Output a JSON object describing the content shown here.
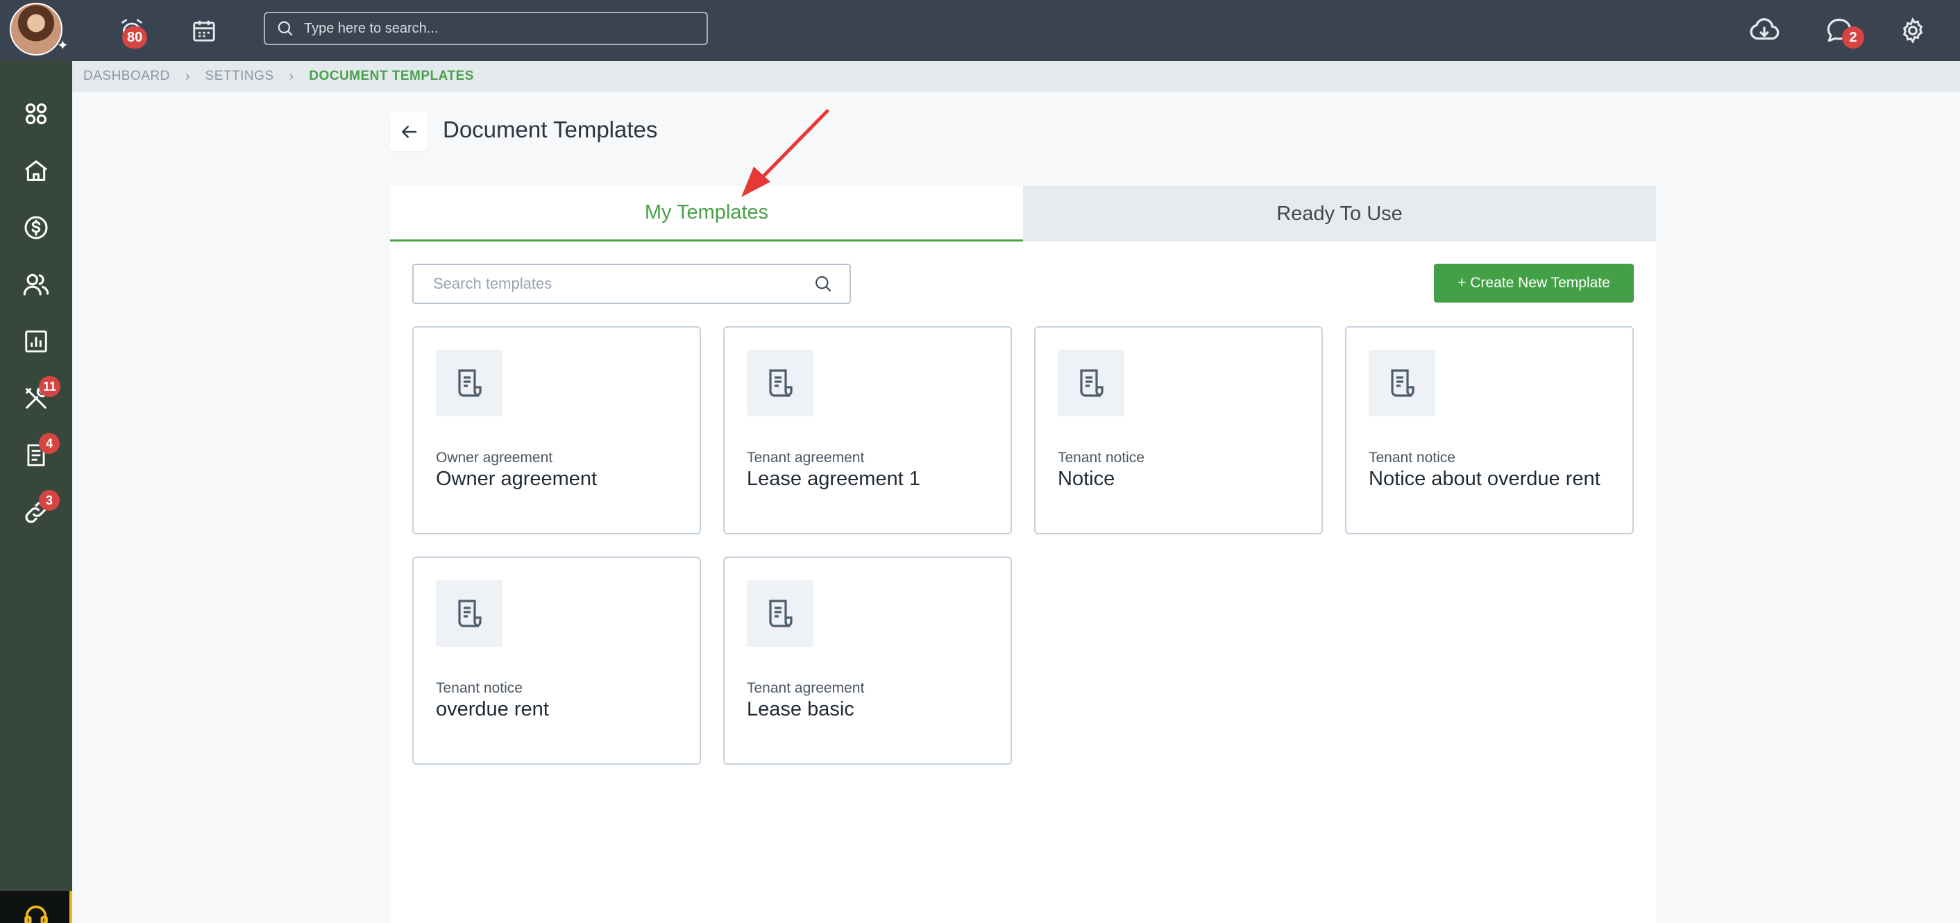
{
  "topbar": {
    "avatar_alt": "User avatar",
    "alarm_badge": "80",
    "search_placeholder": "Type here to search...",
    "messages_badge": "2"
  },
  "sidebar": {
    "items": [
      {
        "icon": "dashboard-grid-icon"
      },
      {
        "icon": "home-icon"
      },
      {
        "icon": "dollar-circle-icon"
      },
      {
        "icon": "people-icon"
      },
      {
        "icon": "reports-chart-icon"
      },
      {
        "icon": "tools-icon",
        "badge": "11"
      },
      {
        "icon": "document-icon",
        "badge": "4"
      },
      {
        "icon": "link-icon",
        "badge": "3"
      }
    ]
  },
  "breadcrumb": {
    "items": [
      "DASHBOARD",
      "SETTINGS",
      "DOCUMENT TEMPLATES"
    ]
  },
  "page": {
    "title": "Document Templates"
  },
  "tabs": [
    {
      "label": "My Templates",
      "active": true
    },
    {
      "label": "Ready To Use",
      "active": false
    }
  ],
  "templates_search": {
    "placeholder": "Search templates"
  },
  "create_button": {
    "label": "+ Create New Template"
  },
  "templates": [
    {
      "category": "Owner agreement",
      "name": "Owner agreement"
    },
    {
      "category": "Tenant agreement",
      "name": "Lease agreement 1"
    },
    {
      "category": "Tenant notice",
      "name": "Notice"
    },
    {
      "category": "Tenant notice",
      "name": "Notice about overdue rent"
    },
    {
      "category": "Tenant notice",
      "name": "overdue rent"
    },
    {
      "category": "Tenant agreement",
      "name": "Lease basic"
    }
  ],
  "colors": {
    "topbar": "#3a4450",
    "sidebar": "#37473b",
    "accent_green": "#43a047",
    "badge_red": "#d64541",
    "annotation_arrow": "#e53935"
  }
}
